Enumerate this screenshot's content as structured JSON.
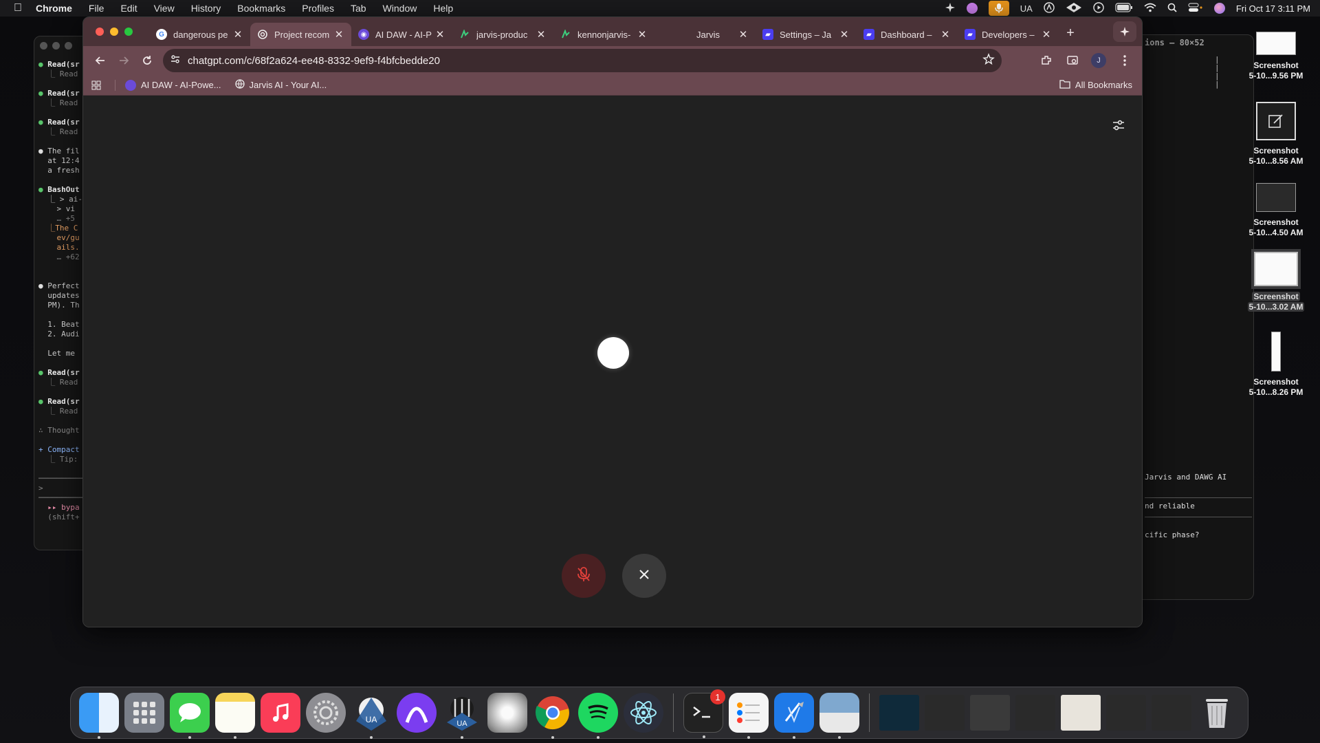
{
  "menubar": {
    "app_name": "Chrome",
    "menus": [
      "File",
      "Edit",
      "View",
      "History",
      "Bookmarks",
      "Profiles",
      "Tab",
      "Window",
      "Help"
    ],
    "status_text": "UA",
    "datetime": "Fri Oct 17  3:11 PM"
  },
  "browser": {
    "tabs": [
      {
        "title": "dangerous pe",
        "favicon": "google-icon",
        "active": false
      },
      {
        "title": "Project recom",
        "favicon": "chatgpt-icon",
        "active": true
      },
      {
        "title": "AI DAW - AI-P",
        "favicon": "ai-daw-icon",
        "active": false
      },
      {
        "title": "jarvis-produc",
        "favicon": "vercel-icon",
        "active": false
      },
      {
        "title": "kennonjarvis-",
        "favicon": "vercel-icon",
        "active": false
      },
      {
        "title": "Jarvis",
        "favicon": "blank-icon",
        "active": false
      },
      {
        "title": "Settings – Ja",
        "favicon": "app-icon",
        "active": false
      },
      {
        "title": "Dashboard –",
        "favicon": "app-icon",
        "active": false
      },
      {
        "title": "Developers –",
        "favicon": "app-icon",
        "active": false
      }
    ],
    "url": "chatgpt.com/c/68f2a624-ee48-8332-9ef9-f4bfcbedde20",
    "profile_initial": "J",
    "bookmarks": [
      {
        "label": "AI DAW - AI-Powe...",
        "icon": "ai-daw-icon"
      },
      {
        "label": "Jarvis AI - Your AI...",
        "icon": "globe-icon"
      }
    ],
    "all_bookmarks_label": "All Bookmarks"
  },
  "voice_mode": {
    "mic_state": "muted",
    "colors": {
      "orb": "#ffffff",
      "mic_button_bg": "#4a2022",
      "mic_icon": "#e0403a",
      "close_button_bg": "#3a3a3a"
    }
  },
  "terminal_left": {
    "lines": [
      {
        "dot": "●",
        "text": "Read(sr",
        "style": "bold",
        "dotc": "g"
      },
      {
        "dot": "",
        "text": "  ⎿ Read",
        "style": "dim"
      },
      {
        "gap": true
      },
      {
        "dot": "●",
        "text": "Read(sr",
        "style": "bold",
        "dotc": "g"
      },
      {
        "dot": "",
        "text": "  ⎿ Read",
        "style": "dim"
      },
      {
        "gap": true
      },
      {
        "dot": "●",
        "text": "Read(sr",
        "style": "bold",
        "dotc": "g"
      },
      {
        "dot": "",
        "text": "  ⎿ Read",
        "style": "dim"
      },
      {
        "gap": true
      },
      {
        "dot": "●",
        "text": "The fil",
        "style": "",
        "dotc": "w"
      },
      {
        "dot": "",
        "text": "  at 12:4",
        "style": ""
      },
      {
        "dot": "",
        "text": "  a fresh",
        "style": ""
      },
      {
        "gap": true
      },
      {
        "dot": "●",
        "text": "BashOut",
        "style": "bold",
        "dotc": "g"
      },
      {
        "dot": "",
        "text": "  ⎿ > ai-",
        "style": ""
      },
      {
        "dot": "",
        "text": "    > vi",
        "style": ""
      },
      {
        "dot": "",
        "text": "    … +5",
        "style": "dim"
      },
      {
        "dot": "",
        "text": "  ⎿The C",
        "style": "orange"
      },
      {
        "dot": "",
        "text": "    ev/gu",
        "style": "orange"
      },
      {
        "dot": "",
        "text": "    ails.",
        "style": "orange"
      },
      {
        "dot": "",
        "text": "    … +62",
        "style": "dim"
      },
      {
        "gap": true
      },
      {
        "gap": true
      },
      {
        "dot": "●",
        "text": "Perfect",
        "style": "",
        "dotc": "w"
      },
      {
        "dot": "",
        "text": "  updates",
        "style": ""
      },
      {
        "dot": "",
        "text": "  PM). Th",
        "style": ""
      },
      {
        "gap": true
      },
      {
        "dot": "",
        "text": "  1. Beat",
        "style": ""
      },
      {
        "dot": "",
        "text": "  2. Audi",
        "style": ""
      },
      {
        "gap": true
      },
      {
        "dot": "",
        "text": "  Let me ",
        "style": ""
      },
      {
        "gap": true
      },
      {
        "dot": "●",
        "text": "Read(sr",
        "style": "bold",
        "dotc": "g"
      },
      {
        "dot": "",
        "text": "  ⎿ Read",
        "style": "dim"
      },
      {
        "gap": true
      },
      {
        "dot": "●",
        "text": "Read(sr",
        "style": "bold",
        "dotc": "g"
      },
      {
        "dot": "",
        "text": "  ⎿ Read",
        "style": "dim"
      },
      {
        "gap": true
      },
      {
        "dot": "",
        "text": "∴ Thought",
        "style": "dim"
      },
      {
        "gap": true
      },
      {
        "dot": "",
        "text": "+ Compact",
        "style": "blue"
      },
      {
        "dot": "",
        "text": "  ⎿ Tip:",
        "style": "dim"
      },
      {
        "gap": true
      },
      {
        "dot": "",
        "text": "──────────",
        "style": "dim"
      },
      {
        "dot": "",
        "text": ">",
        "style": "dim"
      },
      {
        "dot": "",
        "text": "──────────",
        "style": "dim"
      },
      {
        "dot": "",
        "text": "  ▸▸ bypa",
        "style": "pink"
      },
      {
        "dot": "",
        "text": "  (shift+",
        "style": "dim"
      }
    ]
  },
  "terminal_right": {
    "title": "ions — 80×52",
    "message_lines": [
      "Jarvis and DAWG AI",
      "nd reliable",
      "cific phase?"
    ]
  },
  "desktop_screenshots": [
    {
      "line1": "Screenshot",
      "line2": "5-10...9.56 PM",
      "selected": false
    },
    {
      "line1": "Screenshot",
      "line2": "5-10...8.56 AM",
      "selected": false
    },
    {
      "line1": "Screenshot",
      "line2": "5-10...4.50 AM",
      "selected": false
    },
    {
      "line1": "Screenshot",
      "line2": "5-10...3.02 AM",
      "selected": true
    },
    {
      "line1": "Screenshot",
      "line2": "5-10...8.26 PM",
      "selected": false
    }
  ],
  "dock": {
    "apps": [
      {
        "name": "finder-icon",
        "color": "#2d8ef0",
        "running": true
      },
      {
        "name": "launchpad-icon",
        "color": "#8a8f99",
        "running": false
      },
      {
        "name": "messages-icon",
        "color": "#3ccf4e",
        "running": true
      },
      {
        "name": "notes-icon",
        "color": "#f7d55a",
        "running": true
      },
      {
        "name": "music-icon",
        "color": "#fa3d57",
        "running": false
      },
      {
        "name": "system-settings-icon",
        "color": "#8e8e93",
        "running": false
      },
      {
        "name": "ua-connect-icon",
        "color": "#2b5f9e",
        "running": true
      },
      {
        "name": "arc-purple-icon",
        "color": "#7b3df0",
        "running": false
      },
      {
        "name": "ua-console-icon",
        "color": "#2b5f9e",
        "running": true
      },
      {
        "name": "logic-pro-icon",
        "color": "#d0d0d0",
        "running": false
      },
      {
        "name": "chrome-icon",
        "color": "#4285f4",
        "running": true
      },
      {
        "name": "spotify-icon",
        "color": "#1ed760",
        "running": true
      },
      {
        "name": "electron-icon",
        "color": "#47848f",
        "running": false
      }
    ],
    "apps2": [
      {
        "name": "terminal-icon",
        "color": "#222",
        "running": true,
        "badge": "1"
      },
      {
        "name": "reminders-icon",
        "color": "#f5f5f5",
        "running": true
      },
      {
        "name": "xcode-icon",
        "color": "#1f7ae8",
        "running": true
      },
      {
        "name": "preview-icon",
        "color": "#d8e6f2",
        "running": true
      }
    ],
    "minimized_count": 7,
    "trash": "trash-icon"
  }
}
